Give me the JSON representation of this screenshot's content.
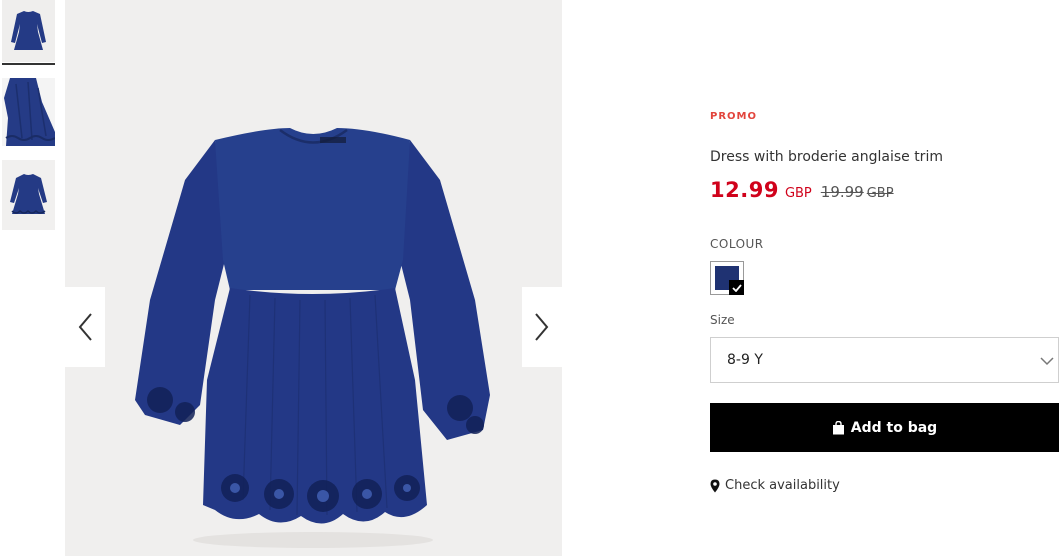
{
  "product": {
    "badge": "PROMO",
    "title": "Dress with broderie anglaise trim",
    "price_new": "12.99",
    "price_new_currency": "GBP",
    "price_old": "19.99",
    "price_old_currency": "GBP"
  },
  "colour": {
    "label": "COLOUR",
    "selected_swatch": "#1f3272"
  },
  "size": {
    "label": "Size",
    "selected": "8-9 Y"
  },
  "actions": {
    "add_to_bag": "Add to bag",
    "check_availability": "Check availability"
  },
  "gallery": {
    "thumbnail_count": 3,
    "active_thumbnail": 1,
    "dress_color": "#243a85"
  },
  "colors": {
    "promo": "#e2443c",
    "sale_price": "#d0021b",
    "button_bg": "#000000"
  }
}
